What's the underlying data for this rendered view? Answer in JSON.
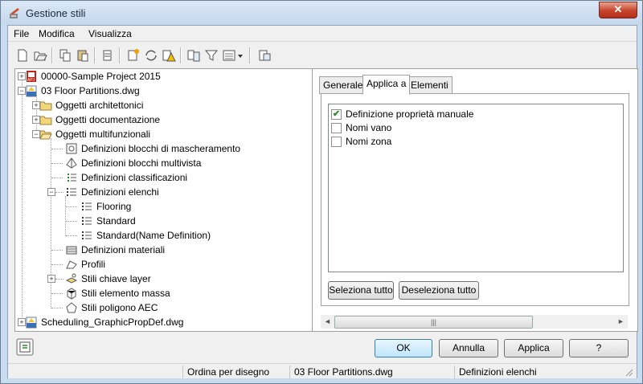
{
  "window": {
    "title": "Gestione stili",
    "close_symbol": "✕"
  },
  "menu": [
    "File",
    "Modifica",
    "Visualizza"
  ],
  "toolbar": {
    "buttons": [
      "new-icon",
      "open-icon",
      "copy-icon",
      "paste-icon",
      "purge-icon",
      "new-style-icon",
      "sync-icon",
      "warning-icon",
      "compare-icon",
      "filter-icon",
      "view-icon",
      "dropdown-arrow-icon",
      "toggle-view-icon"
    ]
  },
  "tree": {
    "items": [
      {
        "label": "00000-Sample Project 2015",
        "icon": "project-icon"
      },
      {
        "label": "03 Floor Partitions.dwg",
        "icon": "drawing-icon"
      },
      {
        "label": "Oggetti architettonici",
        "icon": "folder-icon"
      },
      {
        "label": "Oggetti documentazione",
        "icon": "folder-icon"
      },
      {
        "label": "Oggetti multifunzionali",
        "icon": "folder-open-icon"
      },
      {
        "label": "Definizioni blocchi di mascheramento",
        "icon": "mask-block-icon"
      },
      {
        "label": "Definizioni blocchi multivista",
        "icon": "multiview-block-icon"
      },
      {
        "label": "Definizioni classificazioni",
        "icon": "classification-icon"
      },
      {
        "label": "Definizioni elenchi",
        "icon": "list-icon"
      },
      {
        "label": "Flooring",
        "icon": "list-icon"
      },
      {
        "label": "Standard",
        "icon": "list-icon"
      },
      {
        "label": "Standard(Name Definition)",
        "icon": "list-icon"
      },
      {
        "label": "Definizioni materiali",
        "icon": "material-icon"
      },
      {
        "label": "Profili",
        "icon": "profile-icon"
      },
      {
        "label": "Stili chiave layer",
        "icon": "layer-key-icon"
      },
      {
        "label": "Stili elemento massa",
        "icon": "mass-element-icon"
      },
      {
        "label": "Stili poligono AEC",
        "icon": "polygon-icon"
      },
      {
        "label": "Scheduling_GraphicPropDef.dwg",
        "icon": "drawing-icon"
      }
    ]
  },
  "tabs": [
    "Generale",
    "Applica a",
    "Elementi"
  ],
  "active_tab": "Applica a",
  "apply_to": {
    "items": [
      {
        "label": "Definizione proprietà manuale",
        "checked": true
      },
      {
        "label": "Nomi vano",
        "checked": false
      },
      {
        "label": "Nomi zona",
        "checked": false
      }
    ],
    "select_all": "Seleziona tutto",
    "deselect_all": "Deseleziona tutto"
  },
  "scrollbar": {
    "left_arrow": "◄",
    "right_arrow": "►",
    "grip": "|||"
  },
  "buttons": {
    "ok": "OK",
    "cancel": "Annulla",
    "apply": "Applica",
    "help": "?"
  },
  "status": {
    "sort": "Ordina per disegno",
    "file": "03 Floor Partitions.dwg",
    "selection": "Definizioni elenchi"
  },
  "colors": {
    "accent": "#3c7fb1",
    "close": "#c7432b",
    "folder": "#f1d77a"
  }
}
